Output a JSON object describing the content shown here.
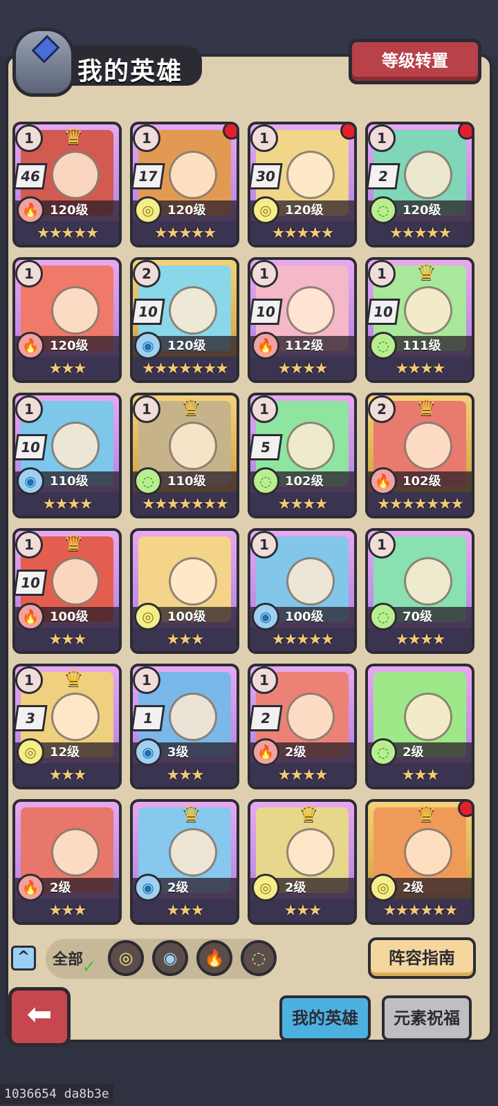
{
  "header": {
    "title": "我的英雄",
    "level_transfer_button": "等级转置"
  },
  "heroes": [
    {
      "rank": "1",
      "count": "46",
      "level": "120级",
      "element": "fire",
      "stars": 5,
      "frame": "purple",
      "crown": true,
      "red_dot": false,
      "bg": "#d35a50"
    },
    {
      "rank": "1",
      "count": "17",
      "level": "120级",
      "element": "earth",
      "stars": 5,
      "frame": "purple",
      "crown": false,
      "red_dot": true,
      "bg": "#e29a52"
    },
    {
      "rank": "1",
      "count": "30",
      "level": "120级",
      "element": "earth",
      "stars": 5,
      "frame": "purple",
      "crown": false,
      "red_dot": true,
      "bg": "#f1d68a"
    },
    {
      "rank": "1",
      "count": "2",
      "level": "120级",
      "element": "wind",
      "stars": 5,
      "frame": "purple",
      "crown": false,
      "red_dot": true,
      "bg": "#7fd6b8"
    },
    {
      "rank": "1",
      "count": "",
      "level": "120级",
      "element": "fire",
      "stars": 3,
      "frame": "purple",
      "crown": false,
      "red_dot": false,
      "bg": "#f07a6a"
    },
    {
      "rank": "2",
      "count": "10",
      "level": "120级",
      "element": "water",
      "stars": 7,
      "frame": "gold",
      "crown": false,
      "red_dot": false,
      "bg": "#8ad7ea"
    },
    {
      "rank": "1",
      "count": "10",
      "level": "112级",
      "element": "fire",
      "stars": 4,
      "frame": "purple",
      "crown": false,
      "red_dot": false,
      "bg": "#f4b8c8"
    },
    {
      "rank": "1",
      "count": "10",
      "level": "111级",
      "element": "wind",
      "stars": 4,
      "frame": "purple",
      "crown": true,
      "red_dot": false,
      "bg": "#a9e89a"
    },
    {
      "rank": "1",
      "count": "10",
      "level": "110级",
      "element": "water",
      "stars": 4,
      "frame": "purple",
      "crown": false,
      "red_dot": false,
      "bg": "#7cc7ea"
    },
    {
      "rank": "1",
      "count": "",
      "level": "110级",
      "element": "wind",
      "stars": 7,
      "frame": "gold",
      "crown": true,
      "red_dot": false,
      "bg": "#c7b38a"
    },
    {
      "rank": "1",
      "count": "5",
      "level": "102级",
      "element": "wind",
      "stars": 4,
      "frame": "purple",
      "crown": false,
      "red_dot": false,
      "bg": "#8fe4a0"
    },
    {
      "rank": "2",
      "count": "",
      "level": "102级",
      "element": "fire",
      "stars": 7,
      "frame": "gold",
      "crown": true,
      "red_dot": false,
      "bg": "#e97a6e"
    },
    {
      "rank": "1",
      "count": "10",
      "level": "100级",
      "element": "fire",
      "stars": 3,
      "frame": "purple",
      "crown": true,
      "red_dot": false,
      "bg": "#e45e50"
    },
    {
      "rank": "",
      "count": "",
      "level": "100级",
      "element": "earth",
      "stars": 3,
      "frame": "purple",
      "crown": false,
      "red_dot": false,
      "bg": "#f3d488"
    },
    {
      "rank": "1",
      "count": "",
      "level": "100级",
      "element": "water",
      "stars": 5,
      "frame": "purple",
      "crown": false,
      "red_dot": false,
      "bg": "#82c6ea"
    },
    {
      "rank": "1",
      "count": "",
      "level": "70级",
      "element": "wind",
      "stars": 4,
      "frame": "purple",
      "crown": false,
      "red_dot": false,
      "bg": "#89e0b0"
    },
    {
      "rank": "1",
      "count": "3",
      "level": "12级",
      "element": "earth",
      "stars": 3,
      "frame": "purple",
      "crown": true,
      "red_dot": false,
      "bg": "#efd07e"
    },
    {
      "rank": "1",
      "count": "1",
      "level": "3级",
      "element": "water",
      "stars": 3,
      "frame": "purple",
      "crown": false,
      "red_dot": false,
      "bg": "#7ab8ea"
    },
    {
      "rank": "1",
      "count": "2",
      "level": "2级",
      "element": "fire",
      "stars": 4,
      "frame": "purple",
      "crown": false,
      "red_dot": false,
      "bg": "#ec8276"
    },
    {
      "rank": "",
      "count": "",
      "level": "2级",
      "element": "wind",
      "stars": 3,
      "frame": "purple",
      "crown": false,
      "red_dot": false,
      "bg": "#9ee88a"
    },
    {
      "rank": "",
      "count": "",
      "level": "2级",
      "element": "fire",
      "stars": 3,
      "frame": "purple",
      "crown": false,
      "red_dot": false,
      "bg": "#e7776a"
    },
    {
      "rank": "",
      "count": "",
      "level": "2级",
      "element": "water",
      "stars": 3,
      "frame": "purple",
      "crown": true,
      "red_dot": false,
      "bg": "#86c8ee"
    },
    {
      "rank": "",
      "count": "",
      "level": "2级",
      "element": "earth",
      "stars": 3,
      "frame": "purple",
      "crown": true,
      "red_dot": false,
      "bg": "#e7d78a"
    },
    {
      "rank": "",
      "count": "",
      "level": "2级",
      "element": "earth",
      "stars": 6,
      "frame": "gold",
      "crown": true,
      "red_dot": true,
      "bg": "#f09a5a"
    }
  ],
  "filter": {
    "all_label": "全部",
    "elements": [
      "earth",
      "water",
      "fire",
      "wind"
    ]
  },
  "buttons": {
    "lineup_guide": "阵容指南",
    "back_icon": "back-arrow-icon"
  },
  "tabs": {
    "my_heroes": "我的英雄",
    "element_blessing": "元素祝福"
  },
  "watermark": "1036654 da8b3e",
  "colors": {
    "fire": "#d9343a",
    "earth": "#c9b020",
    "water": "#1d6fb0",
    "wind": "#2d8a2a",
    "active_tab": "#4db1e0",
    "level_button": "#b8414a",
    "guide_button": "#f5d79d"
  }
}
